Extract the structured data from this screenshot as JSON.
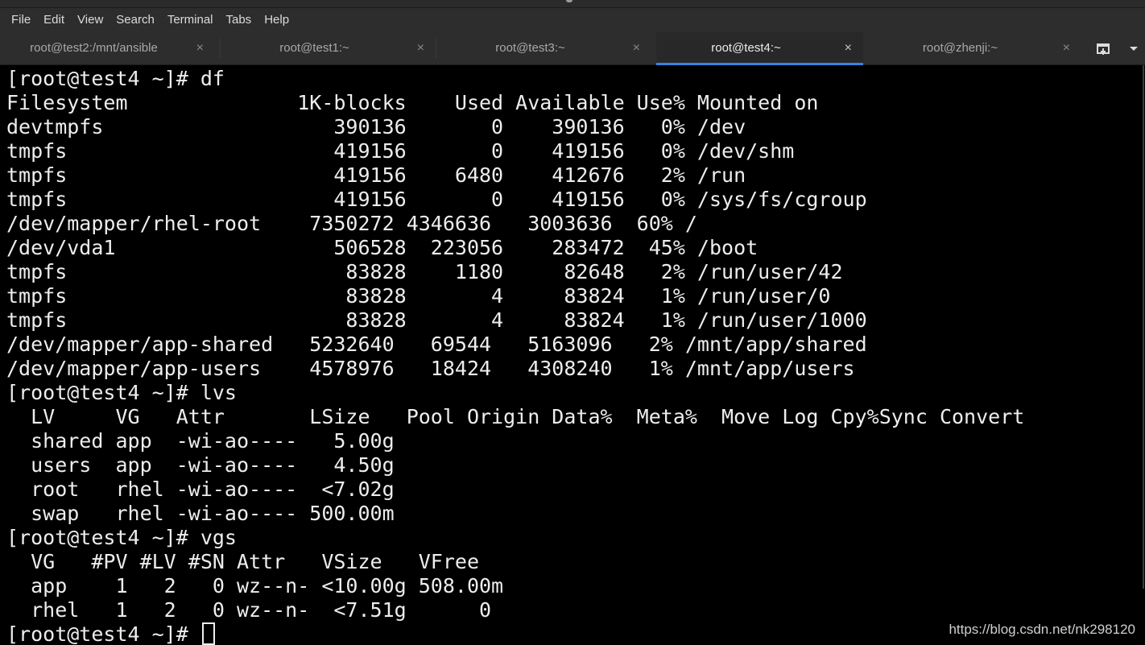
{
  "menubar": {
    "items": [
      "File",
      "Edit",
      "View",
      "Search",
      "Terminal",
      "Tabs",
      "Help"
    ]
  },
  "tabs": [
    {
      "label": "root@test2:/mnt/ansible",
      "close": "×",
      "active": false
    },
    {
      "label": "root@test1:~",
      "close": "×",
      "active": false
    },
    {
      "label": "root@test3:~",
      "close": "×",
      "active": false
    },
    {
      "label": "root@test4:~",
      "close": "×",
      "active": true
    },
    {
      "label": "root@zhenji:~",
      "close": "×",
      "active": false
    }
  ],
  "tab_controls": {
    "new_tab_icon": "new-tab-icon",
    "tab_menu_icon": "chevron-down-icon"
  },
  "colors": {
    "accent": "#3584e4",
    "terminal_bg": "#000000",
    "terminal_fg": "#ededed"
  },
  "terminal": {
    "lines": [
      "[root@test4 ~]# df",
      "Filesystem              1K-blocks    Used Available Use% Mounted on",
      "devtmpfs                   390136       0    390136   0% /dev",
      "tmpfs                      419156       0    419156   0% /dev/shm",
      "tmpfs                      419156    6480    412676   2% /run",
      "tmpfs                      419156       0    419156   0% /sys/fs/cgroup",
      "/dev/mapper/rhel-root    7350272 4346636   3003636  60% /",
      "/dev/vda1                  506528  223056    283472  45% /boot",
      "tmpfs                       83828    1180     82648   2% /run/user/42",
      "tmpfs                       83828       4     83824   1% /run/user/0",
      "tmpfs                       83828       4     83824   1% /run/user/1000",
      "/dev/mapper/app-shared   5232640   69544   5163096   2% /mnt/app/shared",
      "/dev/mapper/app-users    4578976   18424   4308240   1% /mnt/app/users",
      "[root@test4 ~]# lvs",
      "  LV     VG   Attr       LSize   Pool Origin Data%  Meta%  Move Log Cpy%Sync Convert",
      "  shared app  -wi-ao----   5.00g",
      "  users  app  -wi-ao----   4.50g",
      "  root   rhel -wi-ao----  <7.02g",
      "  swap   rhel -wi-ao---- 500.00m",
      "[root@test4 ~]# vgs",
      "  VG   #PV #LV #SN Attr   VSize   VFree",
      "  app    1   2   0 wz--n- <10.00g 508.00m",
      "  rhel   1   2   0 wz--n-  <7.51g      0"
    ],
    "prompt": "[root@test4 ~]# "
  },
  "watermark": "https://blog.csdn.net/nk298120"
}
